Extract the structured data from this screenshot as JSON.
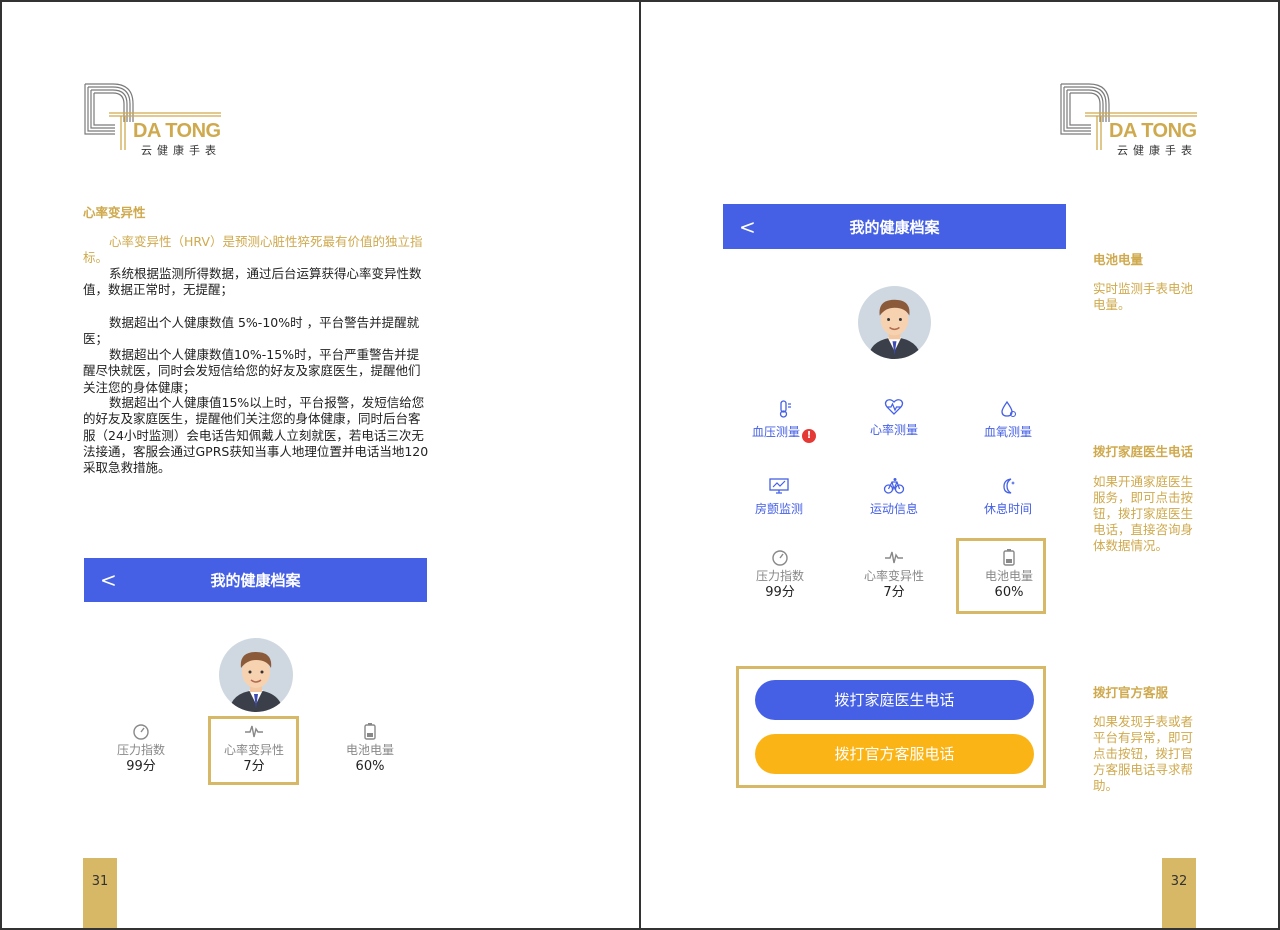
{
  "brand": {
    "name": "DA TONG",
    "subtitle": "云健康手表"
  },
  "left_page": {
    "section_title": "心率变异性",
    "paragraphs": {
      "intro": "心率变异性（HRV）是预测心脏性猝死最有价值的独立指标。",
      "p1": "系统根据监测所得数据，通过后台运算获得心率变异性数值，数据正常时，无提醒；",
      "p2": "数据超出个人健康数值 5%-10%时 ，平台警告并提醒就医；",
      "p3": "数据超出个人健康数值10%-15%时，平台严重警告并提醒尽快就医，同时会发短信给您的好友及家庭医生，提醒他们关注您的身体健康；",
      "p4": "数据超出个人健康值15%以上时，平台报警，发短信给您的好友及家庭医生，提醒他们关注您的身体健康，同时后台客服（24小时监测）会电话告知佩戴人立刻就医，若电话三次无法接通，客服会通过GPRS获知当事人地理位置并电话当地120采取急救措施。"
    },
    "app": {
      "back": "<",
      "title": "我的健康档案"
    },
    "metrics": [
      {
        "label": "压力指数",
        "value": "99分",
        "icon": "gauge-icon"
      },
      {
        "label": "心率变异性",
        "value": "7分",
        "icon": "waveform-icon"
      },
      {
        "label": "电池电量",
        "value": "60%",
        "icon": "battery-icon"
      }
    ],
    "page_number": "31"
  },
  "right_page": {
    "app": {
      "back": "<",
      "title": "我的健康档案"
    },
    "features": [
      {
        "label": "血压测量",
        "icon": "thermometer-icon",
        "alert": "!"
      },
      {
        "label": "心率测量",
        "icon": "heart-pulse-icon"
      },
      {
        "label": "血氧测量",
        "icon": "droplet-icon"
      },
      {
        "label": "房颤监测",
        "icon": "monitor-chart-icon"
      },
      {
        "label": "运动信息",
        "icon": "bicycle-icon"
      },
      {
        "label": "休息时间",
        "icon": "moon-icon"
      }
    ],
    "metrics": [
      {
        "label": "压力指数",
        "value": "99分",
        "icon": "gauge-icon"
      },
      {
        "label": "心率变异性",
        "value": "7分",
        "icon": "waveform-icon"
      },
      {
        "label": "电池电量",
        "value": "60%",
        "icon": "battery-icon"
      }
    ],
    "buttons": {
      "call_doctor": "拨打家庭医生电话",
      "call_service": "拨打官方客服电话"
    },
    "notes": [
      {
        "title": "电池电量",
        "text": "实时监测手表电池电量。"
      },
      {
        "title": "拨打家庭医生电话",
        "text": "如果开通家庭医生服务，即可点击按钮，拨打家庭医生电话，直接咨询身体数据情况。"
      },
      {
        "title": "拨打官方客服",
        "text": "如果发现手表或者平台有异常，即可点击按钮，拨打官方客服电话寻求帮助。"
      }
    ],
    "page_number": "32"
  },
  "colors": {
    "accent_blue": "#4560e5",
    "gold": "#cfa94d",
    "yellow": "#fbb416",
    "alert_red": "#e53935"
  }
}
